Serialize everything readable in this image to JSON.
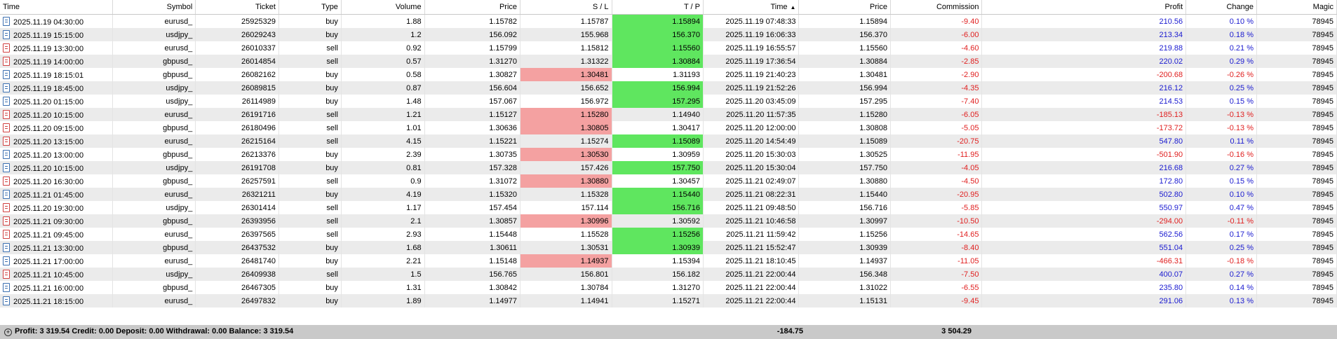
{
  "columns": [
    {
      "key": "time",
      "label": "Time",
      "align": "l"
    },
    {
      "key": "symbol",
      "label": "Symbol",
      "align": "r"
    },
    {
      "key": "ticket",
      "label": "Ticket",
      "align": "r"
    },
    {
      "key": "type",
      "label": "Type",
      "align": "r"
    },
    {
      "key": "volume",
      "label": "Volume",
      "align": "r"
    },
    {
      "key": "price",
      "label": "Price",
      "align": "r"
    },
    {
      "key": "sl",
      "label": "S / L",
      "align": "r"
    },
    {
      "key": "tp",
      "label": "T / P",
      "align": "r"
    },
    {
      "key": "close_time",
      "label": "Time",
      "align": "r",
      "sorted": "asc"
    },
    {
      "key": "close_price",
      "label": "Price",
      "align": "r"
    },
    {
      "key": "commission",
      "label": "Commission",
      "align": "r"
    },
    {
      "key": "profit",
      "label": "Profit",
      "align": "r"
    },
    {
      "key": "change",
      "label": "Change",
      "align": "r"
    },
    {
      "key": "magic",
      "label": "Magic",
      "align": "r"
    }
  ],
  "sort_arrow": "▲",
  "rows": [
    {
      "time": "2025.11.19 04:30:00",
      "symbol": "eurusd_",
      "ticket": "25925329",
      "type": "buy",
      "volume": "1.88",
      "price": "1.15782",
      "sl": "1.15787",
      "tp": "1.15894",
      "close_time": "2025.11.19 07:48:33",
      "close_price": "1.15894",
      "commission": "-9.40",
      "profit": "210.56",
      "change": "0.10 %",
      "magic": "78945",
      "hit": "tp"
    },
    {
      "time": "2025.11.19 15:15:00",
      "symbol": "usdjpy_",
      "ticket": "26029243",
      "type": "buy",
      "volume": "1.2",
      "price": "156.092",
      "sl": "155.968",
      "tp": "156.370",
      "close_time": "2025.11.19 16:06:33",
      "close_price": "156.370",
      "commission": "-6.00",
      "profit": "213.34",
      "change": "0.18 %",
      "magic": "78945",
      "hit": "tp"
    },
    {
      "time": "2025.11.19 13:30:00",
      "symbol": "eurusd_",
      "ticket": "26010337",
      "type": "sell",
      "volume": "0.92",
      "price": "1.15799",
      "sl": "1.15812",
      "tp": "1.15560",
      "close_time": "2025.11.19 16:55:57",
      "close_price": "1.15560",
      "commission": "-4.60",
      "profit": "219.88",
      "change": "0.21 %",
      "magic": "78945",
      "hit": "tp"
    },
    {
      "time": "2025.11.19 14:00:00",
      "symbol": "gbpusd_",
      "ticket": "26014854",
      "type": "sell",
      "volume": "0.57",
      "price": "1.31270",
      "sl": "1.31322",
      "tp": "1.30884",
      "close_time": "2025.11.19 17:36:54",
      "close_price": "1.30884",
      "commission": "-2.85",
      "profit": "220.02",
      "change": "0.29 %",
      "magic": "78945",
      "hit": "tp"
    },
    {
      "time": "2025.11.19 18:15:01",
      "symbol": "gbpusd_",
      "ticket": "26082162",
      "type": "buy",
      "volume": "0.58",
      "price": "1.30827",
      "sl": "1.30481",
      "tp": "1.31193",
      "close_time": "2025.11.19 21:40:23",
      "close_price": "1.30481",
      "commission": "-2.90",
      "profit": "-200.68",
      "change": "-0.26 %",
      "magic": "78945",
      "hit": "sl"
    },
    {
      "time": "2025.11.19 18:45:00",
      "symbol": "usdjpy_",
      "ticket": "26089815",
      "type": "buy",
      "volume": "0.87",
      "price": "156.604",
      "sl": "156.652",
      "tp": "156.994",
      "close_time": "2025.11.19 21:52:26",
      "close_price": "156.994",
      "commission": "-4.35",
      "profit": "216.12",
      "change": "0.25 %",
      "magic": "78945",
      "hit": "tp"
    },
    {
      "time": "2025.11.20 01:15:00",
      "symbol": "usdjpy_",
      "ticket": "26114989",
      "type": "buy",
      "volume": "1.48",
      "price": "157.067",
      "sl": "156.972",
      "tp": "157.295",
      "close_time": "2025.11.20 03:45:09",
      "close_price": "157.295",
      "commission": "-7.40",
      "profit": "214.53",
      "change": "0.15 %",
      "magic": "78945",
      "hit": "tp"
    },
    {
      "time": "2025.11.20 10:15:00",
      "symbol": "eurusd_",
      "ticket": "26191716",
      "type": "sell",
      "volume": "1.21",
      "price": "1.15127",
      "sl": "1.15280",
      "tp": "1.14940",
      "close_time": "2025.11.20 11:57:35",
      "close_price": "1.15280",
      "commission": "-6.05",
      "profit": "-185.13",
      "change": "-0.13 %",
      "magic": "78945",
      "hit": "sl"
    },
    {
      "time": "2025.11.20 09:15:00",
      "symbol": "gbpusd_",
      "ticket": "26180496",
      "type": "sell",
      "volume": "1.01",
      "price": "1.30636",
      "sl": "1.30805",
      "tp": "1.30417",
      "close_time": "2025.11.20 12:00:00",
      "close_price": "1.30808",
      "commission": "-5.05",
      "profit": "-173.72",
      "change": "-0.13 %",
      "magic": "78945",
      "hit": "sl"
    },
    {
      "time": "2025.11.20 13:15:00",
      "symbol": "eurusd_",
      "ticket": "26215164",
      "type": "sell",
      "volume": "4.15",
      "price": "1.15221",
      "sl": "1.15274",
      "tp": "1.15089",
      "close_time": "2025.11.20 14:54:49",
      "close_price": "1.15089",
      "commission": "-20.75",
      "profit": "547.80",
      "change": "0.11 %",
      "magic": "78945",
      "hit": "tp"
    },
    {
      "time": "2025.11.20 13:00:00",
      "symbol": "gbpusd_",
      "ticket": "26213376",
      "type": "buy",
      "volume": "2.39",
      "price": "1.30735",
      "sl": "1.30530",
      "tp": "1.30959",
      "close_time": "2025.11.20 15:30:03",
      "close_price": "1.30525",
      "commission": "-11.95",
      "profit": "-501.90",
      "change": "-0.16 %",
      "magic": "78945",
      "hit": "sl"
    },
    {
      "time": "2025.11.20 10:15:00",
      "symbol": "usdjpy_",
      "ticket": "26191708",
      "type": "buy",
      "volume": "0.81",
      "price": "157.328",
      "sl": "157.426",
      "tp": "157.750",
      "close_time": "2025.11.20 15:30:04",
      "close_price": "157.750",
      "commission": "-4.05",
      "profit": "216.68",
      "change": "0.27 %",
      "magic": "78945",
      "hit": "tp"
    },
    {
      "time": "2025.11.20 16:30:00",
      "symbol": "gbpusd_",
      "ticket": "26257591",
      "type": "sell",
      "volume": "0.9",
      "price": "1.31072",
      "sl": "1.30880",
      "tp": "1.30457",
      "close_time": "2025.11.21 02:49:07",
      "close_price": "1.30880",
      "commission": "-4.50",
      "profit": "172.80",
      "change": "0.15 %",
      "magic": "78945",
      "hit": "sl"
    },
    {
      "time": "2025.11.21 01:45:00",
      "symbol": "eurusd_",
      "ticket": "26321211",
      "type": "buy",
      "volume": "4.19",
      "price": "1.15320",
      "sl": "1.15328",
      "tp": "1.15440",
      "close_time": "2025.11.21 08:22:31",
      "close_price": "1.15440",
      "commission": "-20.95",
      "profit": "502.80",
      "change": "0.10 %",
      "magic": "78945",
      "hit": "tp"
    },
    {
      "time": "2025.11.20 19:30:00",
      "symbol": "usdjpy_",
      "ticket": "26301414",
      "type": "sell",
      "volume": "1.17",
      "price": "157.454",
      "sl": "157.114",
      "tp": "156.716",
      "close_time": "2025.11.21 09:48:50",
      "close_price": "156.716",
      "commission": "-5.85",
      "profit": "550.97",
      "change": "0.47 %",
      "magic": "78945",
      "hit": "tp"
    },
    {
      "time": "2025.11.21 09:30:00",
      "symbol": "gbpusd_",
      "ticket": "26393956",
      "type": "sell",
      "volume": "2.1",
      "price": "1.30857",
      "sl": "1.30996",
      "tp": "1.30592",
      "close_time": "2025.11.21 10:46:58",
      "close_price": "1.30997",
      "commission": "-10.50",
      "profit": "-294.00",
      "change": "-0.11 %",
      "magic": "78945",
      "hit": "sl"
    },
    {
      "time": "2025.11.21 09:45:00",
      "symbol": "eurusd_",
      "ticket": "26397565",
      "type": "sell",
      "volume": "2.93",
      "price": "1.15448",
      "sl": "1.15528",
      "tp": "1.15256",
      "close_time": "2025.11.21 11:59:42",
      "close_price": "1.15256",
      "commission": "-14.65",
      "profit": "562.56",
      "change": "0.17 %",
      "magic": "78945",
      "hit": "tp"
    },
    {
      "time": "2025.11.21 13:30:00",
      "symbol": "gbpusd_",
      "ticket": "26437532",
      "type": "buy",
      "volume": "1.68",
      "price": "1.30611",
      "sl": "1.30531",
      "tp": "1.30939",
      "close_time": "2025.11.21 15:52:47",
      "close_price": "1.30939",
      "commission": "-8.40",
      "profit": "551.04",
      "change": "0.25 %",
      "magic": "78945",
      "hit": "tp"
    },
    {
      "time": "2025.11.21 17:00:00",
      "symbol": "eurusd_",
      "ticket": "26481740",
      "type": "buy",
      "volume": "2.21",
      "price": "1.15148",
      "sl": "1.14937",
      "tp": "1.15394",
      "close_time": "2025.11.21 18:10:45",
      "close_price": "1.14937",
      "commission": "-11.05",
      "profit": "-466.31",
      "change": "-0.18 %",
      "magic": "78945",
      "hit": "sl"
    },
    {
      "time": "2025.11.21 10:45:00",
      "symbol": "usdjpy_",
      "ticket": "26409938",
      "type": "sell",
      "volume": "1.5",
      "price": "156.765",
      "sl": "156.801",
      "tp": "156.182",
      "close_time": "2025.11.21 22:00:44",
      "close_price": "156.348",
      "commission": "-7.50",
      "profit": "400.07",
      "change": "0.27 %",
      "magic": "78945",
      "hit": ""
    },
    {
      "time": "2025.11.21 16:00:00",
      "symbol": "gbpusd_",
      "ticket": "26467305",
      "type": "buy",
      "volume": "1.31",
      "price": "1.30842",
      "sl": "1.30784",
      "tp": "1.31270",
      "close_time": "2025.11.21 22:00:44",
      "close_price": "1.31022",
      "commission": "-6.55",
      "profit": "235.80",
      "change": "0.14 %",
      "magic": "78945",
      "hit": ""
    },
    {
      "time": "2025.11.21 18:15:00",
      "symbol": "eurusd_",
      "ticket": "26497832",
      "type": "buy",
      "volume": "1.89",
      "price": "1.14977",
      "sl": "1.14941",
      "tp": "1.15271",
      "close_time": "2025.11.21 22:00:44",
      "close_price": "1.15131",
      "commission": "-9.45",
      "profit": "291.06",
      "change": "0.13 %",
      "magic": "78945",
      "hit": ""
    }
  ],
  "footer": {
    "summary": "Profit: 3 319.54  Credit: 0.00  Deposit: 0.00  Withdrawal: 0.00  Balance: 3 319.54",
    "commission_total": "-184.75",
    "profit_total": "3 504.29"
  },
  "colors": {
    "sl_hit": "#f4a1a1",
    "tp_hit": "#5fe65f",
    "negative": "#e02020",
    "positive": "#1a1ad0"
  }
}
